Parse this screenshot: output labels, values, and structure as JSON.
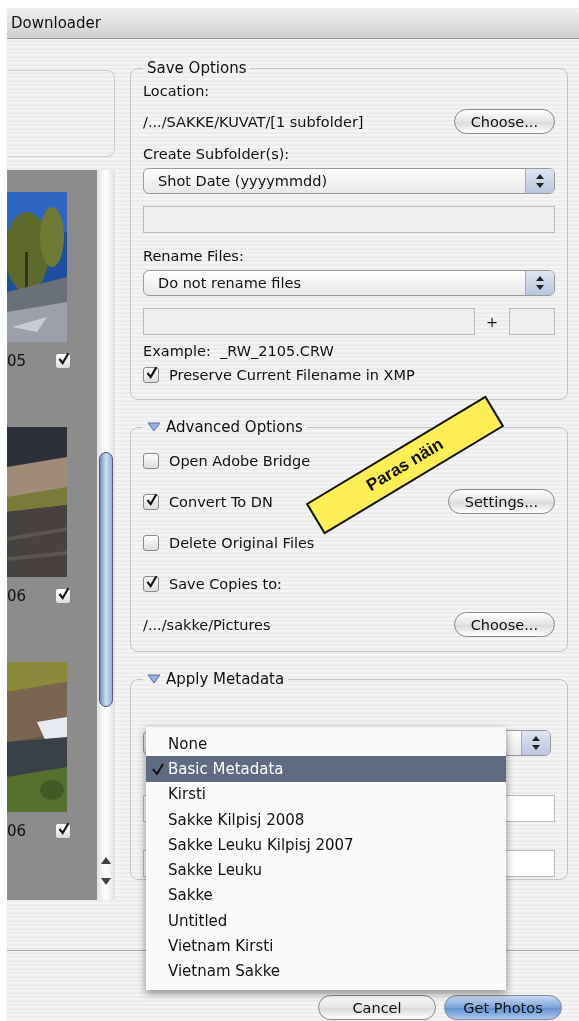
{
  "window": {
    "title": "Downloader"
  },
  "thumbnails": [
    {
      "label": "05",
      "checked": true
    },
    {
      "label": "06",
      "checked": true
    },
    {
      "label": "06",
      "checked": true
    }
  ],
  "save_options": {
    "title": "Save Options",
    "location_label": "Location:",
    "location": "/.../SAKKE/KUVAT/[1 subfolder]",
    "choose_button": "Choose...",
    "subfolder_label": "Create Subfolder(s):",
    "subfolder_value": "Shot Date (yyyymmdd)",
    "rename_label": "Rename Files:",
    "rename_value": "Do not rename files",
    "plus": "+",
    "example": "Example:  _RW_2105.CRW",
    "preserve": {
      "label": "Preserve Current Filename in XMP",
      "checked": true
    }
  },
  "advanced_options": {
    "title": "Advanced Options",
    "expanded": true,
    "options": [
      {
        "label": "Open Adobe Bridge",
        "checked": false
      },
      {
        "label": "Convert To DN",
        "checked": true,
        "button": "Settings..."
      },
      {
        "label": "Delete Original Files",
        "checked": false
      },
      {
        "label": "Save Copies to:",
        "checked": true
      }
    ],
    "save_path": "/.../sakke/Pictures",
    "choose_button": "Choose..."
  },
  "apply_metadata": {
    "title": "Apply Metadata",
    "expanded": true
  },
  "template_menu": {
    "items": [
      {
        "label": "None",
        "selected": false
      },
      {
        "label": "Basic Metadata",
        "selected": true
      },
      {
        "label": "Kirsti",
        "selected": false
      },
      {
        "label": "Sakke Kilpisj 2008",
        "selected": false
      },
      {
        "label": "Sakke Leuku Kilpisj 2007",
        "selected": false
      },
      {
        "label": "Sakke Leuku",
        "selected": false
      },
      {
        "label": "Sakke",
        "selected": false
      },
      {
        "label": "Untitled",
        "selected": false
      },
      {
        "label": "Vietnam Kirsti",
        "selected": false
      },
      {
        "label": "Vietnam Sakke",
        "selected": false
      }
    ]
  },
  "buttons": [
    "Cancel",
    "Get Photos"
  ],
  "note": {
    "text": "Paras näin"
  }
}
